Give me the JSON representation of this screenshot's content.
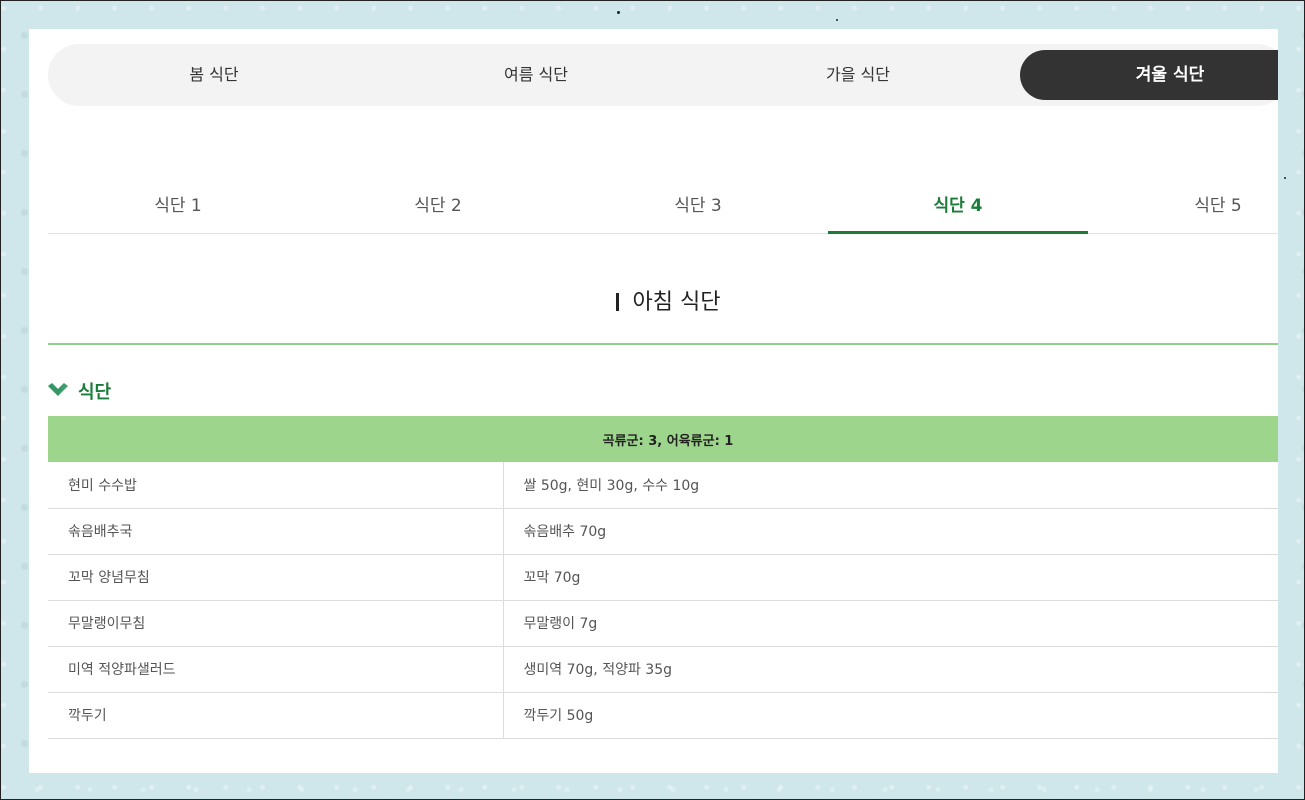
{
  "seasons": [
    "봄 식단",
    "여름 식단",
    "가을 식단",
    "겨울 식단"
  ],
  "active_season": "겨울 식단",
  "diet_tabs": [
    "식단 1",
    "식단 2",
    "식단 3",
    "식단 4",
    "식단 5"
  ],
  "active_diet_tab": "식단 4",
  "meal_title": "아침 식단",
  "section_title": "식단",
  "table": {
    "header": "곡류군: 3, 어육류군: 1",
    "rows": [
      {
        "name": "현미 수수밥",
        "ingredients": "쌀 50g, 현미 30g, 수수 10g"
      },
      {
        "name": "솎음배추국",
        "ingredients": "솎음배추 70g"
      },
      {
        "name": "꼬막 양념무침",
        "ingredients": "꼬막 70g"
      },
      {
        "name": "무말랭이무침",
        "ingredients": "무말랭이 7g"
      },
      {
        "name": "미역 적양파샐러드",
        "ingredients": "생미역 70g, 적양파 35g"
      },
      {
        "name": "깍두기",
        "ingredients": "깍두기 50g"
      }
    ]
  },
  "colors": {
    "accent_green": "#1b7c3a",
    "table_header_green": "#9dd58c",
    "active_season_bg": "#333333",
    "page_bg": "#cfe6ea"
  },
  "icons": {
    "section": "chevron-down-icon"
  }
}
